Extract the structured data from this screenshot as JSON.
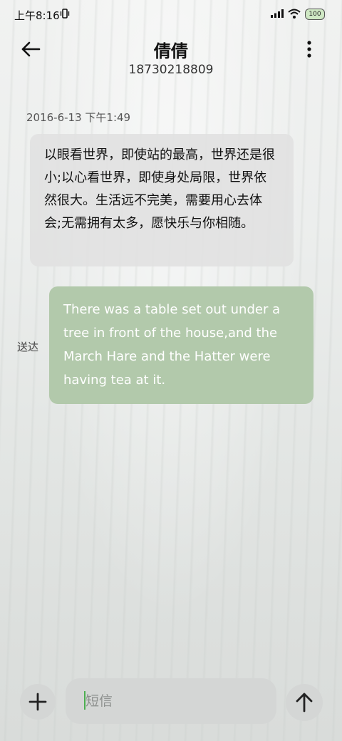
{
  "status_bar": {
    "time": "上午8:16",
    "battery": "100"
  },
  "header": {
    "contact_name": "倩倩",
    "contact_number": "18730218809"
  },
  "conversation": {
    "timestamp": "2016-6-13 下午1:49",
    "incoming_message": "以眼看世界，即使站的最高，世界还是很小;以心看世界，即使身处局限，世界依然很大。生活远不完美，需要用心去体会;无需拥有太多，愿快乐与你相随。",
    "outgoing_message": "There was a table set out under a tree in front of the house,and the March Hare and the Hatter were having tea at it.",
    "outgoing_status": "送达",
    "outgoing_color": "#b2c9ab"
  },
  "composer": {
    "placeholder": "短信",
    "value": ""
  },
  "icons": {
    "back": "arrow-left-icon",
    "more": "more-vertical-icon",
    "add": "plus-icon",
    "send": "arrow-up-icon"
  }
}
